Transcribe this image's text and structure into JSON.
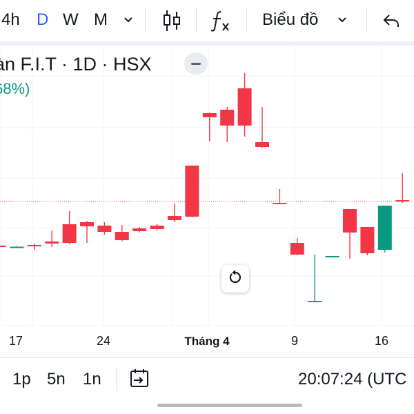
{
  "toolbar": {
    "intervals": [
      "4h",
      "D",
      "W",
      "M"
    ],
    "active_interval": "D",
    "chart_type_label": "Biểu đồ"
  },
  "legend": {
    "title": "àn F.I.T · 1D · HSX",
    "change": "68%)"
  },
  "chart_data": {
    "type": "candlestick",
    "up_color": "#089981",
    "down_color": "#f23645",
    "x_tick_labels": [
      "17",
      "24",
      "Tháng 4",
      "9",
      "16"
    ],
    "price_line_color": "#f23645",
    "grid": true,
    "candles": [
      {
        "o": 356.0,
        "h": 357.0,
        "l": 356.0,
        "c": 356.5
      },
      {
        "o": 357.5,
        "h": 358.5,
        "l": 356.5,
        "c": 357.5
      },
      {
        "o": 355.0,
        "h": 362.0,
        "l": 353.0,
        "c": 356.0
      },
      {
        "o": 350.0,
        "h": 334.0,
        "l": 358.0,
        "c": 353.0
      },
      {
        "o": 325.0,
        "h": 306.0,
        "l": 354.0,
        "c": 352.0
      },
      {
        "o": 322.0,
        "h": 320.0,
        "l": 352.0,
        "c": 328.0
      },
      {
        "o": 327.0,
        "h": 322.0,
        "l": 340.0,
        "c": 336.0
      },
      {
        "o": 336.0,
        "h": 326.0,
        "l": 350.0,
        "c": 348.0
      },
      {
        "o": 331.0,
        "h": 329.0,
        "l": 337.0,
        "c": 335.0
      },
      {
        "o": 327.0,
        "h": 325.0,
        "l": 334.0,
        "c": 332.0
      },
      {
        "o": 313.0,
        "h": 295.0,
        "l": 322.0,
        "c": 319.0
      },
      {
        "o": 240.0,
        "h": 240.0,
        "l": 315.0,
        "c": 314.0
      },
      {
        "o": 164.0,
        "h": 163.0,
        "l": 205.0,
        "c": 170.0
      },
      {
        "o": 159.0,
        "h": 155.0,
        "l": 206.0,
        "c": 182.0
      },
      {
        "o": 128.0,
        "h": 106.0,
        "l": 198.0,
        "c": 182.0
      },
      {
        "o": 206.0,
        "h": 155.0,
        "l": 214.0,
        "c": 213.0
      },
      {
        "o": 294.0,
        "h": 274.0,
        "l": 296.0,
        "c": 295.0
      },
      {
        "o": 352.0,
        "h": 345.0,
        "l": 370.0,
        "c": 369.0
      },
      {
        "o": 436.0,
        "h": 369.0,
        "l": 438.0,
        "c": 436.0
      },
      {
        "o": 371.0,
        "h": 371.0,
        "l": 372.0,
        "c": 371.0
      },
      {
        "o": 303.0,
        "h": 303.0,
        "l": 375.0,
        "c": 337.0
      },
      {
        "o": 329.0,
        "h": 329.0,
        "l": 370.0,
        "c": 367.0
      },
      {
        "o": 362.0,
        "h": 298.0,
        "l": 366.0,
        "c": 298.0
      },
      {
        "o": 290.0,
        "h": 251.0,
        "l": 294.0,
        "c": 292.0
      }
    ]
  },
  "reset_icon": "rotate-ccw-icon",
  "bottombar": {
    "ranges": [
      "1p",
      "5n",
      "1n"
    ],
    "time": "20:07:24 (UTC"
  }
}
